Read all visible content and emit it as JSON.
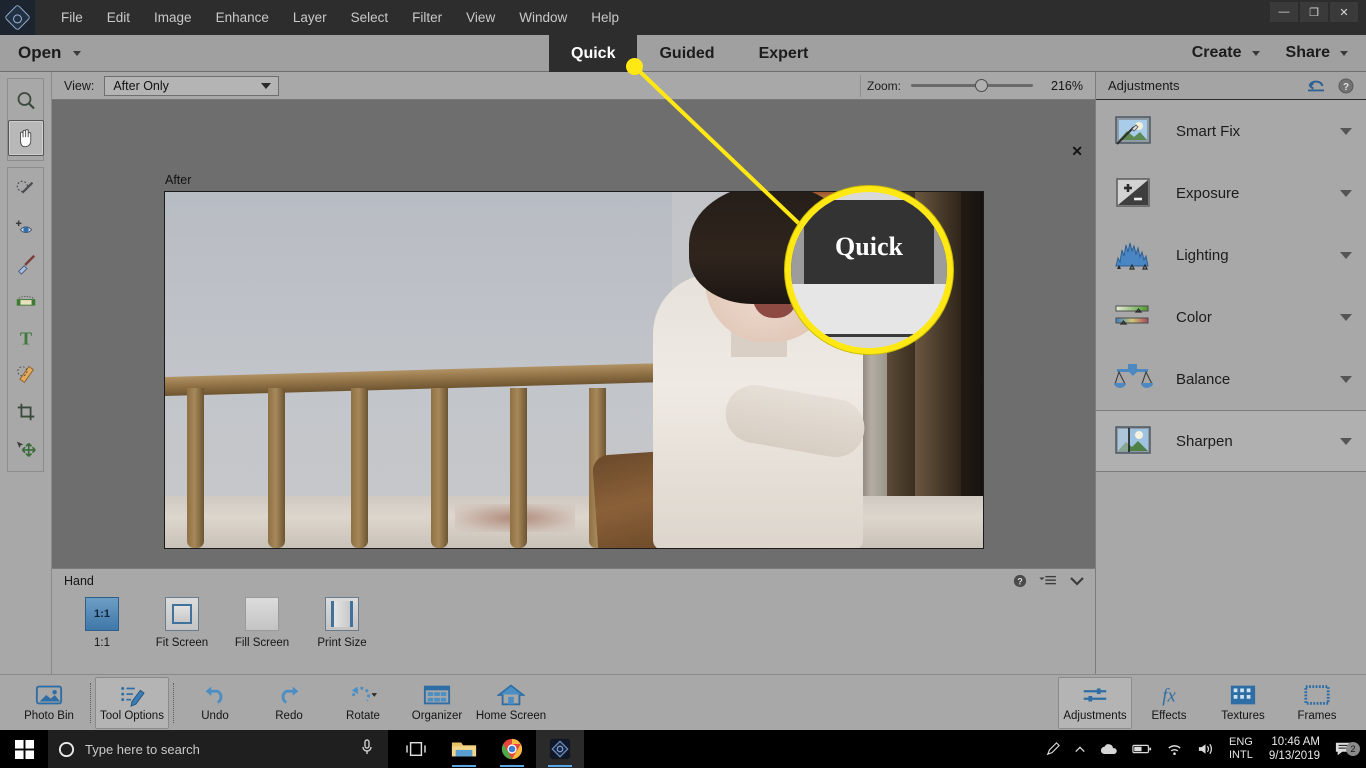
{
  "app": {
    "title_menu": [
      "File",
      "Edit",
      "Image",
      "Enhance",
      "Layer",
      "Select",
      "Filter",
      "View",
      "Window",
      "Help"
    ],
    "logo_icon": "photoshop-elements-logo-icon",
    "window_controls": [
      {
        "name": "minimize-button",
        "glyph": "—"
      },
      {
        "name": "restore-button",
        "glyph": "❐"
      },
      {
        "name": "close-button",
        "glyph": "✕"
      }
    ]
  },
  "modebar": {
    "open_label": "Open",
    "modes": [
      {
        "label": "Quick",
        "active": true
      },
      {
        "label": "Guided",
        "active": false
      },
      {
        "label": "Expert",
        "active": false
      }
    ],
    "create_label": "Create",
    "share_label": "Share"
  },
  "toolbar": {
    "groups": [
      {
        "tools": [
          {
            "name": "zoom-tool",
            "icon": "magnifier-icon",
            "active": false
          },
          {
            "name": "hand-tool",
            "icon": "hand-icon",
            "active": true
          }
        ]
      },
      {
        "tools": [
          {
            "name": "quick-selection-tool",
            "icon": "magic-wand-icon",
            "active": false
          },
          {
            "name": "red-eye-removal-tool",
            "icon": "eye-icon",
            "active": false
          },
          {
            "name": "spot-healing-brush-tool",
            "icon": "brush-icon",
            "active": false
          },
          {
            "name": "whiten-teeth-tool",
            "icon": "teeth-icon",
            "active": false
          },
          {
            "name": "type-tool",
            "icon": "text-t-icon",
            "active": false
          },
          {
            "name": "pencil-tool",
            "icon": "ruler-pencil-icon",
            "active": false
          },
          {
            "name": "crop-tool",
            "icon": "crop-icon",
            "active": false
          },
          {
            "name": "move-tool",
            "icon": "move-arrows-icon",
            "active": false
          }
        ]
      }
    ]
  },
  "options_row": {
    "view_label": "View:",
    "view_value": "After Only",
    "zoom_label": "Zoom:",
    "zoom_value": "216%",
    "zoom_percent": 52
  },
  "canvas": {
    "after_label": "After",
    "close_icon": "✕"
  },
  "callout": {
    "magnified_text": "Quick",
    "accent_color": "#FFE814"
  },
  "tool_options": {
    "title": "Hand",
    "help_icon": "question-mark-icon",
    "menu_icon": "panel-menu-icon",
    "collapse_icon": "chevron-down-icon",
    "items": [
      {
        "label": "1:1",
        "swatch": "one-to-one",
        "selected": true
      },
      {
        "label": "Fit Screen",
        "swatch": "fit-screen",
        "selected": false
      },
      {
        "label": "Fill Screen",
        "swatch": "fill-screen",
        "selected": false
      },
      {
        "label": "Print Size",
        "swatch": "print-size",
        "selected": false
      }
    ]
  },
  "adjustments_panel": {
    "title": "Adjustments",
    "reset_icon": "undo-arrow-icon",
    "help_icon": "question-mark-icon",
    "rows": [
      {
        "label": "Smart Fix",
        "icon": "smart-fix-icon",
        "selected": false
      },
      {
        "label": "Exposure",
        "icon": "exposure-icon",
        "selected": false
      },
      {
        "label": "Lighting",
        "icon": "histogram-icon",
        "selected": false
      },
      {
        "label": "Color",
        "icon": "color-sliders-icon",
        "selected": false
      },
      {
        "label": "Balance",
        "icon": "balance-scale-icon",
        "selected": false
      },
      {
        "label": "Sharpen",
        "icon": "sharpen-icon",
        "selected": true
      }
    ]
  },
  "app_bottom_bar": {
    "left_items": [
      {
        "label": "Photo Bin",
        "icon": "photo-bin-icon",
        "boxed": false
      },
      {
        "label": "Tool Options",
        "icon": "tool-options-icon",
        "boxed": true
      },
      {
        "label": "Undo",
        "icon": "undo-icon",
        "boxed": false
      },
      {
        "label": "Redo",
        "icon": "redo-icon",
        "boxed": false
      },
      {
        "label": "Rotate",
        "icon": "rotate-icon",
        "boxed": false
      },
      {
        "label": "Organizer",
        "icon": "organizer-grid-icon",
        "boxed": false
      },
      {
        "label": "Home Screen",
        "icon": "home-icon",
        "boxed": false
      }
    ],
    "right_items": [
      {
        "label": "Adjustments",
        "icon": "sliders-icon",
        "boxed": true
      },
      {
        "label": "Effects",
        "icon": "fx-icon",
        "boxed": false
      },
      {
        "label": "Textures",
        "icon": "textures-grid-icon",
        "boxed": false
      },
      {
        "label": "Frames",
        "icon": "frame-icon",
        "boxed": false
      }
    ]
  },
  "taskbar": {
    "start_icon": "windows-start-icon",
    "search_placeholder": "Type here to search",
    "search_icon": "search-circle-icon",
    "mic_icon": "microphone-icon",
    "apps": [
      {
        "name": "task-view-icon",
        "running": false
      },
      {
        "name": "file-explorer-icon",
        "running": true
      },
      {
        "name": "chrome-icon",
        "running": true
      },
      {
        "name": "photoshop-elements-icon",
        "running": true
      }
    ],
    "tray": {
      "chevron_icon": "chevron-up-icon",
      "cloud_icon": "cloud-icon",
      "battery_icon": "battery-icon",
      "wifi_icon": "wifi-icon",
      "volume_icon": "volume-icon",
      "language_line1": "ENG",
      "language_line2": "INTL",
      "time": "10:46 AM",
      "date": "9/13/2019",
      "notification_icon": "notification-icon",
      "notification_count": "2"
    }
  }
}
